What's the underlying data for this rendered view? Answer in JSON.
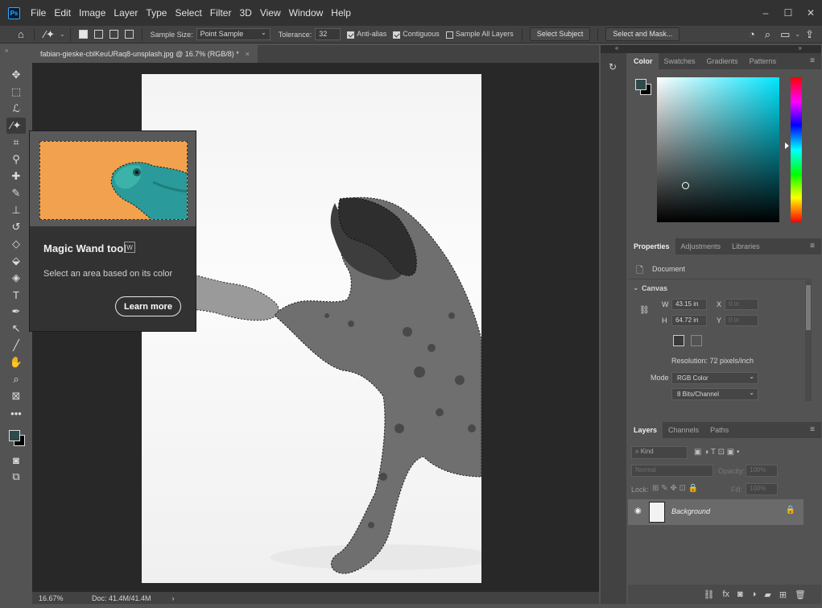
{
  "app": {
    "logo": "Ps"
  },
  "menu": [
    "File",
    "Edit",
    "Image",
    "Layer",
    "Type",
    "Select",
    "Filter",
    "3D",
    "View",
    "Window",
    "Help"
  ],
  "window_controls": {
    "minimize": "–",
    "maximize": "☐",
    "close": "✕"
  },
  "options_bar": {
    "sample_size_label": "Sample Size:",
    "sample_size_value": "Point Sample",
    "tolerance_label": "Tolerance:",
    "tolerance_value": "32",
    "anti_alias": "Anti-alias",
    "contiguous": "Contiguous",
    "sample_all_layers": "Sample All Layers",
    "select_subject": "Select Subject",
    "select_and_mask": "Select and Mask..."
  },
  "document": {
    "tab_title": "fabian-gieske-cblKeuURaq8-unsplash.jpg @ 16.7% (RGB/8) *",
    "tab_close": "×",
    "zoom": "16.67%",
    "doc_size": "Doc: 41.4M/41.4M",
    "status_arrow": "›"
  },
  "tooltip": {
    "title": "Magic Wand tool",
    "shortcut": "W",
    "description": "Select an area based on its color",
    "learn_more": "Learn more"
  },
  "color_panel": {
    "tabs": [
      "Color",
      "Swatches",
      "Gradients",
      "Patterns"
    ],
    "foreground": "#2f4a4a",
    "background": "#000000"
  },
  "properties_panel": {
    "tabs": [
      "Properties",
      "Adjustments",
      "Libraries"
    ],
    "document_label": "Document",
    "canvas_label": "Canvas",
    "w_label": "W",
    "w_value": "43.15 in",
    "h_label": "H",
    "h_value": "64.72 in",
    "x_label": "X",
    "x_value": "0 in",
    "y_label": "Y",
    "y_value": "0 in",
    "resolution": "Resolution: 72 pixels/inch",
    "mode_label": "Mode",
    "mode_value": "RGB Color",
    "bits_value": "8 Bits/Channel"
  },
  "layers_panel": {
    "tabs": [
      "Layers",
      "Channels",
      "Paths"
    ],
    "kind_placeholder": "Kind",
    "blend_mode": "Normal",
    "opacity_label": "Opacity:",
    "opacity_value": "100%",
    "lock_label": "Lock:",
    "fill_label": "Fill:",
    "fill_value": "100%",
    "layer_name": "Background"
  }
}
